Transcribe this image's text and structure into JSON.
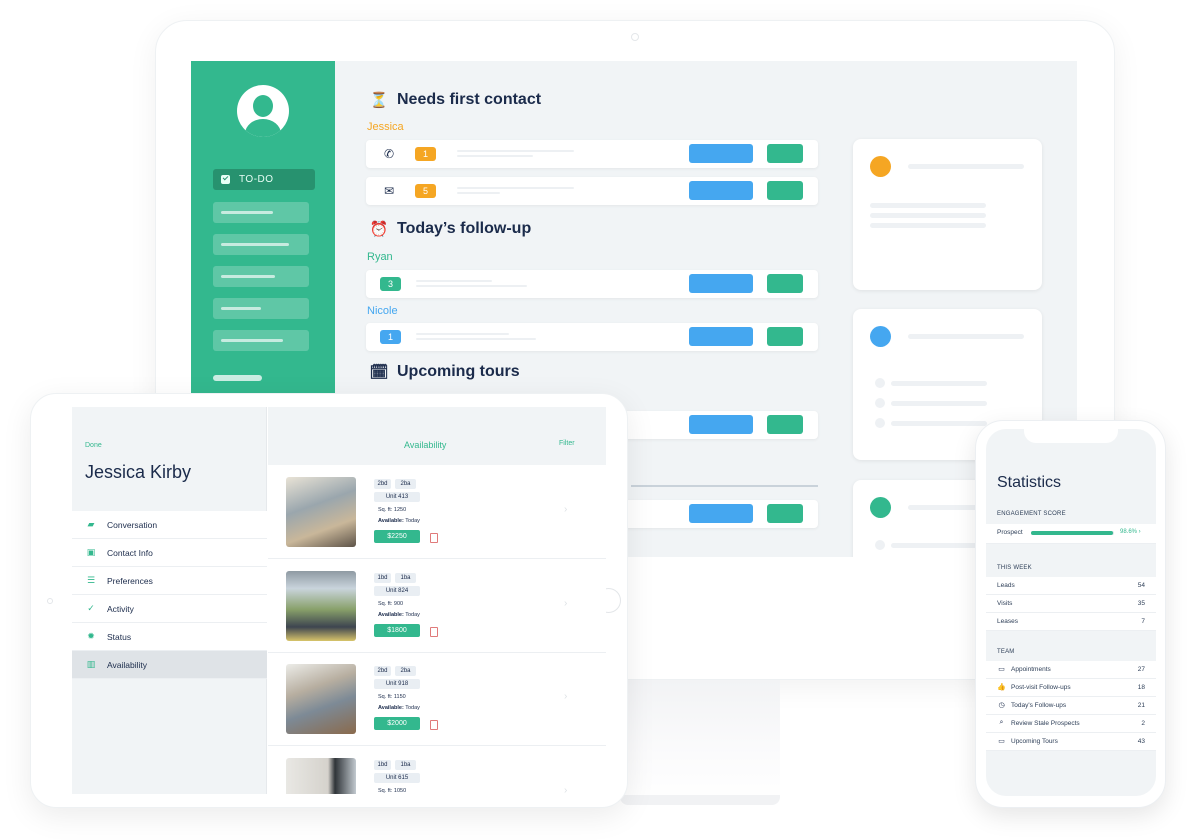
{
  "desktop": {
    "sidebar": {
      "active_item": "TO-DO",
      "placeholder_items": 5
    },
    "sections": [
      {
        "title": "Needs first contact",
        "icon": "hourglass-icon",
        "icon_glyph": "⏳",
        "groups": [
          {
            "agent": "Jessica",
            "agent_color": "#f5a623",
            "rows": [
              {
                "channel": "phone-icon",
                "channel_glyph": "📞",
                "count": "1",
                "badge_color": "#f5a623"
              },
              {
                "channel": "envelope-open-icon",
                "channel_glyph": "✉",
                "count": "5",
                "badge_color": "#f5a623"
              }
            ]
          }
        ]
      },
      {
        "title": "Today’s follow-up",
        "icon": "alarm-clock-icon",
        "icon_glyph": "⏰",
        "groups": [
          {
            "agent": "Ryan",
            "agent_color": "#33b88e",
            "rows": [
              {
                "count": "3",
                "badge_color": "#33b88e"
              }
            ]
          },
          {
            "agent": "Nicole",
            "agent_color": "#45a7f0",
            "rows": [
              {
                "count": "1",
                "badge_color": "#45a7f0"
              }
            ]
          }
        ]
      },
      {
        "title": "Upcoming tours",
        "icon": "calendar-icon",
        "icon_glyph": "🗓"
      }
    ],
    "cards": [
      {
        "dot_color": "#f5a623"
      },
      {
        "dot_color": "#45a7f0"
      },
      {
        "dot_color": "#33b88e"
      }
    ]
  },
  "tablet": {
    "done_label": "Done",
    "client_name": "Jessica Kirby",
    "menu": [
      {
        "label": "Conversation",
        "icon": "chat-icon",
        "glyph": "▰"
      },
      {
        "label": "Contact Info",
        "icon": "id-card-icon",
        "glyph": "▣"
      },
      {
        "label": "Preferences",
        "icon": "sliders-icon",
        "glyph": "☰"
      },
      {
        "label": "Activity",
        "icon": "check-double-icon",
        "glyph": "✓"
      },
      {
        "label": "Status",
        "icon": "gear-icon",
        "glyph": "✹"
      },
      {
        "label": "Availability",
        "icon": "building-icon",
        "glyph": "▥",
        "active": true
      }
    ],
    "header": {
      "title": "Availability",
      "filter_label": "Filter"
    },
    "listings": [
      {
        "beds": "2bd",
        "baths": "2ba",
        "unit": "Unit 413",
        "sqft": "Sq. ft: 1250",
        "available_label": "Available:",
        "available": "Today",
        "price": "$2250"
      },
      {
        "beds": "1bd",
        "baths": "1ba",
        "unit": "Unit 824",
        "sqft": "Sq. ft: 900",
        "available_label": "Available:",
        "available": "Today",
        "price": "$1800"
      },
      {
        "beds": "2bd",
        "baths": "2ba",
        "unit": "Unit 918",
        "sqft": "Sq. ft: 1150",
        "available_label": "Available:",
        "available": "Today",
        "price": "$2000"
      },
      {
        "beds": "1bd",
        "baths": "1ba",
        "unit": "Unit 615",
        "sqft": "Sq. ft: 1050"
      }
    ]
  },
  "phone": {
    "title": "Statistics",
    "engagement": {
      "label": "ENGAGEMENT SCORE",
      "name": "Prospect",
      "value_text": "98.6%",
      "value": 0.986
    },
    "this_week": {
      "label": "THIS WEEK",
      "rows": [
        {
          "label": "Leads",
          "value": "54"
        },
        {
          "label": "Visits",
          "value": "35"
        },
        {
          "label": "Leases",
          "value": "7"
        }
      ]
    },
    "team": {
      "label": "TEAM",
      "rows": [
        {
          "label": "Appointments",
          "value": "27",
          "icon": "calendar-icon",
          "glyph": "▭"
        },
        {
          "label": "Post-visit Follow-ups",
          "value": "18",
          "icon": "thumbs-up-icon",
          "glyph": "👍"
        },
        {
          "label": "Today's Follow-ups",
          "value": "21",
          "icon": "timer-icon",
          "glyph": "◷"
        },
        {
          "label": "Review Stale Prospects",
          "value": "2",
          "icon": "search-icon",
          "glyph": "⌕"
        },
        {
          "label": "Upcoming Tours",
          "value": "43",
          "icon": "calendar-icon",
          "glyph": "▭"
        }
      ]
    }
  }
}
